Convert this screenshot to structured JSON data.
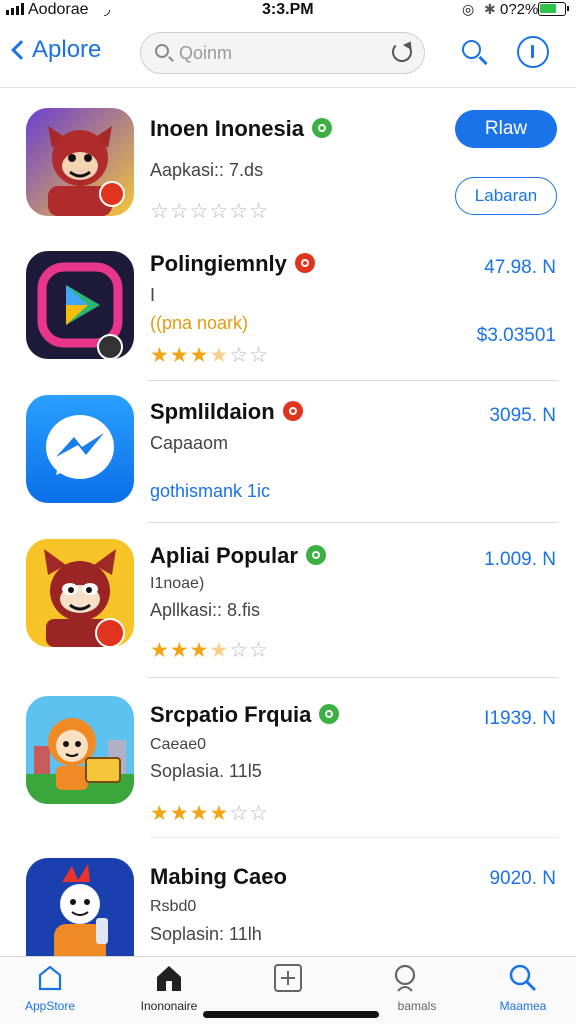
{
  "status_bar": {
    "carrier": "Aodorae",
    "time": "3:3.PM",
    "battery_text": "0?2%",
    "battery_level": 0.6
  },
  "nav": {
    "back_label": "Aplore",
    "search_text": "Qoinm",
    "icons": [
      "chevron-left-icon",
      "search-icon",
      "reload-icon",
      "info-icon"
    ]
  },
  "apps": [
    {
      "name": "Inoen Inonesia",
      "badge_color": "#3cb043",
      "line1": "Aapkasi:: 7.ds",
      "rating": 0,
      "primary_button": "Rlaw",
      "secondary_button": "Labaran"
    },
    {
      "name": "Polingiemnly",
      "badge_color": "#e0341e",
      "line1": "I",
      "line2": "((pna noark)",
      "rating": 3.5,
      "price": "47.98. N",
      "price2": "$3.03501"
    },
    {
      "name": "Spmlildaion",
      "badge_color": "#e0341e",
      "line1": "Capaaom",
      "line2": "gothismank 1ic",
      "price": "3095. N"
    },
    {
      "name": "Apliai Popular",
      "badge_color": "#3cb043",
      "line1": "I1noae)",
      "line2": "Apllkasi:: 8.fis",
      "rating": 3.5,
      "price": "1.009. N"
    },
    {
      "name": "Srcpatio Frquia",
      "badge_color": "#3cb043",
      "line1": "Caeae0",
      "line2": "Soplasia. 11l5",
      "rating": 4,
      "price": "I1939. N"
    },
    {
      "name": "Mabing Caeo",
      "line1": "Rsbd0",
      "line2": "Soplasin: 11lh",
      "price": "9020. N"
    }
  ],
  "tabs": [
    {
      "label": "AppStore",
      "icon": "app-store-icon",
      "active": true
    },
    {
      "label": "Inononaire",
      "icon": "home-icon",
      "active": false
    },
    {
      "label": "",
      "icon": "plus-square-icon",
      "active": false
    },
    {
      "label": "bamals",
      "icon": "search-icon",
      "active": false
    },
    {
      "label": "Maamea",
      "icon": "search-icon",
      "active": true
    }
  ]
}
